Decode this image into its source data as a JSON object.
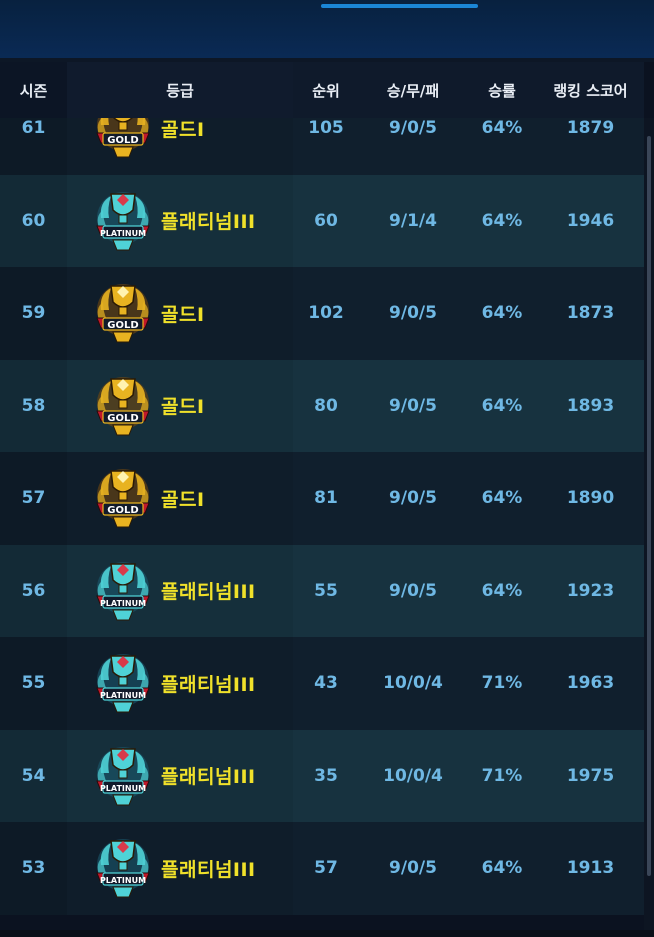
{
  "header": {
    "season": "시즌",
    "grade": "등급",
    "rank": "순위",
    "wdl": "승/무/패",
    "winrate": "승률",
    "score": "랭킹 스코어"
  },
  "rows": [
    {
      "season": "61",
      "badge": "gold",
      "grade": "골드I",
      "rank": "105",
      "wdl": "9/0/5",
      "winrate": "64%",
      "score": "1879"
    },
    {
      "season": "60",
      "badge": "platinum",
      "grade": "플래티넘III",
      "rank": "60",
      "wdl": "9/1/4",
      "winrate": "64%",
      "score": "1946"
    },
    {
      "season": "59",
      "badge": "gold",
      "grade": "골드I",
      "rank": "102",
      "wdl": "9/0/5",
      "winrate": "64%",
      "score": "1873"
    },
    {
      "season": "58",
      "badge": "gold",
      "grade": "골드I",
      "rank": "80",
      "wdl": "9/0/5",
      "winrate": "64%",
      "score": "1893"
    },
    {
      "season": "57",
      "badge": "gold",
      "grade": "골드I",
      "rank": "81",
      "wdl": "9/0/5",
      "winrate": "64%",
      "score": "1890"
    },
    {
      "season": "56",
      "badge": "platinum",
      "grade": "플래티넘III",
      "rank": "55",
      "wdl": "9/0/5",
      "winrate": "64%",
      "score": "1923"
    },
    {
      "season": "55",
      "badge": "platinum",
      "grade": "플래티넘III",
      "rank": "43",
      "wdl": "10/0/4",
      "winrate": "71%",
      "score": "1963"
    },
    {
      "season": "54",
      "badge": "platinum",
      "grade": "플래티넘III",
      "rank": "35",
      "wdl": "10/0/4",
      "winrate": "71%",
      "score": "1975"
    },
    {
      "season": "53",
      "badge": "platinum",
      "grade": "플래티넘III",
      "rank": "57",
      "wdl": "9/0/5",
      "winrate": "64%",
      "score": "1913"
    }
  ],
  "badges": {
    "gold": {
      "text": "GOLD",
      "primary": "#e8b321",
      "secondary": "#7a4a0c",
      "ribbon": "#c0182a"
    },
    "platinum": {
      "text": "PLATINUM",
      "primary": "#4fd2d6",
      "secondary": "#1c5d73",
      "ribbon": "#c0182a"
    }
  },
  "colors": {
    "grade_text": "#f0e12a",
    "value_text": "#6fb8e4",
    "tab_indicator": "#1b86d6"
  }
}
